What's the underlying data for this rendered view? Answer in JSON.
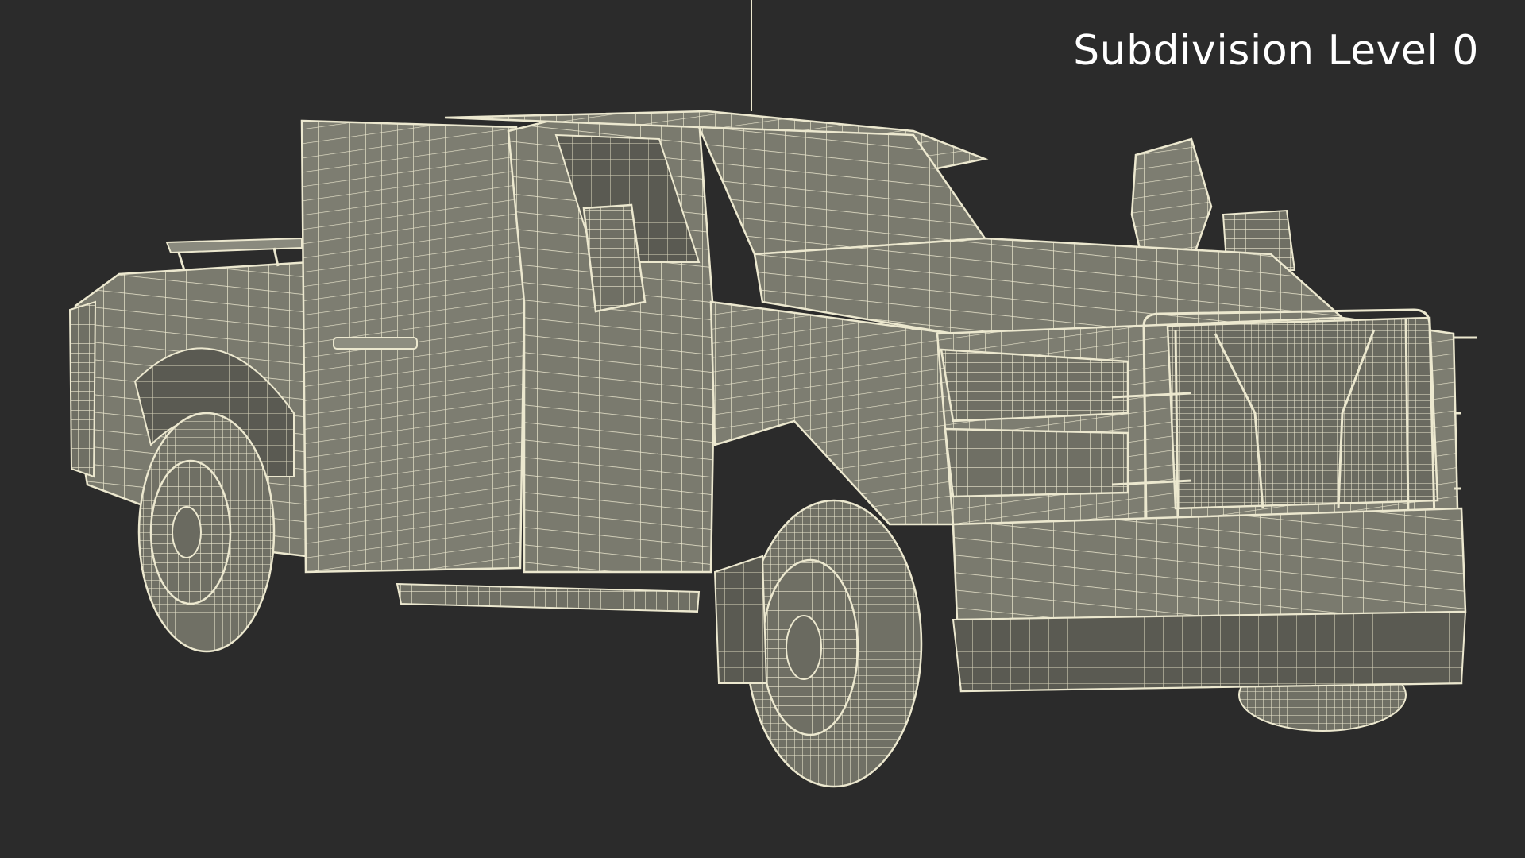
{
  "caption": "Subdivision Level 0",
  "colors": {
    "background": "#2b2b2b",
    "body": "#7c7c70",
    "body_dark": "#5f5f55",
    "wire": "#ece8cf",
    "caption": "#ffffff"
  },
  "subject": {
    "icon": "pickup-truck-wireframe"
  }
}
